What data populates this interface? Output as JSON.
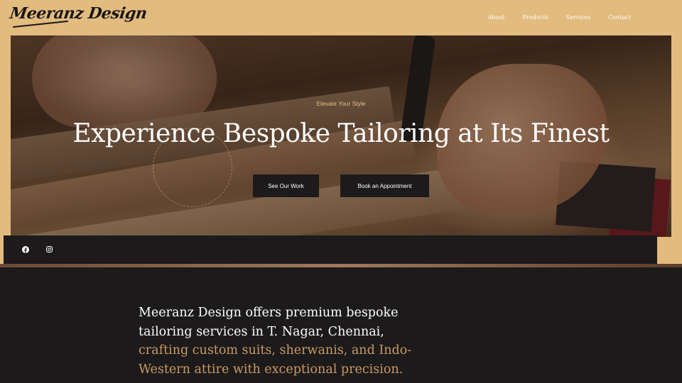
{
  "brand": {
    "logo_text": "Meeranz Design"
  },
  "nav": {
    "items": [
      {
        "label": "About"
      },
      {
        "label": "Products"
      },
      {
        "label": "Services"
      },
      {
        "label": "Contact"
      }
    ]
  },
  "hero": {
    "tagline": "Elevate Your Style",
    "headline": "Experience Bespoke Tailoring at Its Finest",
    "buttons": {
      "work_label": "See Our Work",
      "book_label": "Book an Appointment"
    }
  },
  "social": {
    "icons": [
      "facebook-icon",
      "instagram-icon"
    ]
  },
  "about": {
    "lines_white": [
      "Meeranz Design offers premium bespoke",
      "tailoring services in T. Nagar, Chennai,"
    ],
    "lines_gold": [
      "crafting custom suits, sherwanis, and Indo-",
      "Western attire with exceptional precision."
    ]
  },
  "colors": {
    "accent": "#e2bb7e",
    "dark": "#1c1a1b",
    "gold_text": "#c99a62",
    "tagline": "#e7c08a"
  }
}
